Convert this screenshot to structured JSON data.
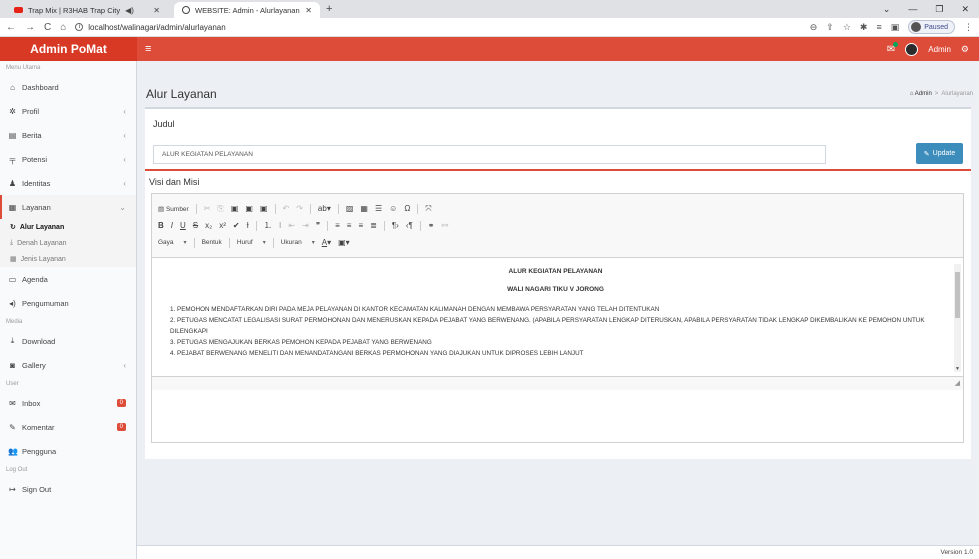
{
  "browser": {
    "tab1": "Trap Mix | R3HAB Trap City",
    "tab2": "WEBSITE: Admin - Alurlayanan",
    "url": "localhost/walinagari/admin/alurlayanan",
    "profile_status": "Paused"
  },
  "header": {
    "logo": "Admin PoMat",
    "user": "Admin"
  },
  "sidebar": {
    "section_main": "Menu Utama",
    "dashboard": "Dashboard",
    "profil": "Profil",
    "berita": "Berita",
    "potensi": "Potensi",
    "identitas": "Identitas",
    "layanan": "Layanan",
    "alur_layanan": "Alur Layanan",
    "denah_layanan": "Denah Layanan",
    "jenis_layanan": "Jenis Layanan",
    "agenda": "Agenda",
    "pengumuman": "Pengumuman",
    "section_media": "Media",
    "download": "Download",
    "gallery": "Gallery",
    "section_user": "User",
    "inbox": "Inbox",
    "inbox_badge": "0",
    "komentar": "Komentar",
    "komentar_badge": "0",
    "pengguna": "Pengguna",
    "section_logout": "Log Out",
    "signout": "Sign Out"
  },
  "page": {
    "title": "Alur Layanan",
    "crumb_home": "Admin",
    "crumb_sep": ">",
    "crumb_current": "Alurlayanan",
    "judul_label": "Judul",
    "judul_value": "ALUR KEGIATAN PELAYANAN",
    "update_label": "Update",
    "visi_label": "Visi dan Misi",
    "version": "Version 1.0"
  },
  "editor": {
    "source_label": "Sumber",
    "style_combo": "Gaya",
    "format_combo": "Bentuk",
    "font_combo": "Huruf",
    "size_combo": "Ukuran",
    "heading1": "ALUR KEGIATAN PELAYANAN",
    "heading2": "WALI NAGARI TIKU V JORONG",
    "item1": "1. PEMOHON MENDAFTARKAN DIRI PADA MEJA PELAYANAN DI KANTOR KECAMATAN KALIMANAH DENGAN MEMBAWA PERSYARATAN YANG TELAH DITENTUKAN",
    "item2": "2. PETUGAS MENCATAT LEGALISASI SURAT PERMOHONAN DAN MENERUSKAN KEPADA PEJABAT YANG BERWENANG. (APABILA PERSYARATAN LENGKAP DITERUSKAN, APABILA PERSYARATAN TIDAK LENGKAP DIKEMBALIKAN KE PEMOHON UNTUK DILENGKAPI",
    "item3": "3. PETUGAS MENGAJUKAN BERKAS PEMOHON KEPADA PEJABAT YANG BERWENANG",
    "item4": "4. PEJABAT BERWENANG MENELITI DAN MENANDATANGANI BERKAS PERMOHONAN YANG DIAJUKAN UNTUK DIPROSES LEBIH LANJUT"
  },
  "colors": {
    "header_red": "#dd4b39",
    "button_blue": "#3c8dbc"
  }
}
